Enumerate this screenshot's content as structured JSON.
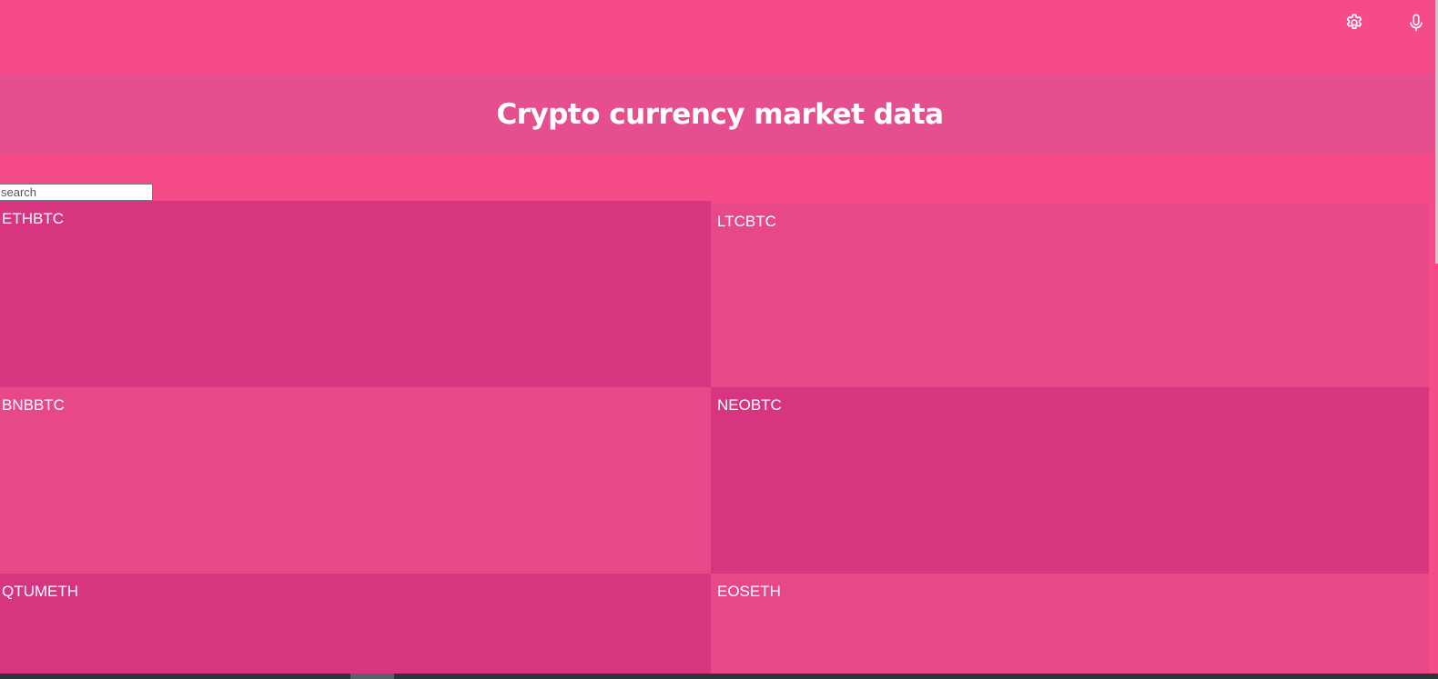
{
  "header": {
    "settings_icon": "gear-icon",
    "mic_icon": "microphone-icon"
  },
  "title": "Crypto currency market data",
  "search": {
    "placeholder": "search",
    "value": ""
  },
  "tiles": [
    {
      "label": "ETHBTC",
      "color": "#d83581"
    },
    {
      "label": "LTCBTC",
      "color": "#e74887"
    },
    {
      "label": "BNBBTC",
      "color": "#e74887"
    },
    {
      "label": "NEOBTC",
      "color": "#d83581"
    },
    {
      "label": "QTUMETH",
      "color": "#d83581"
    },
    {
      "label": "EOSETH",
      "color": "#e74887"
    }
  ],
  "colors": {
    "background": "#f54b88",
    "title_band": "#e64f8f",
    "tile_dark": "#d83581",
    "tile_light": "#e74887"
  }
}
